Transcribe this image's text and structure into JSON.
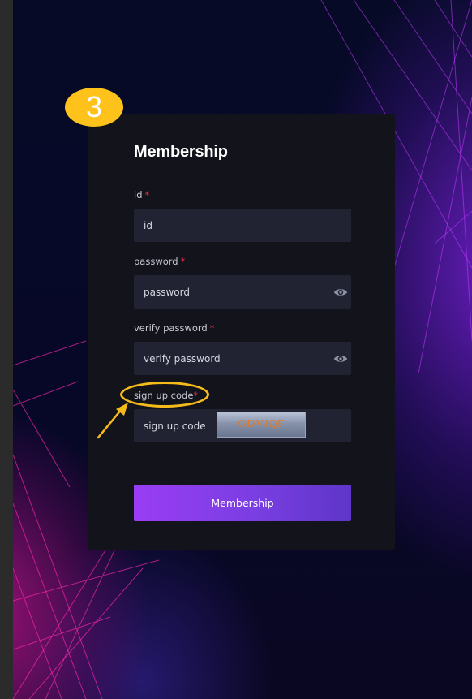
{
  "step_badge": "3",
  "form": {
    "title": "Membership",
    "required_mark": "*",
    "id": {
      "label": "id",
      "placeholder": "id"
    },
    "password": {
      "label": "password",
      "placeholder": "password"
    },
    "verify_password": {
      "label": "verify password",
      "placeholder": "verify password"
    },
    "signup_code": {
      "label": "sign up code",
      "placeholder": "sign up code",
      "captcha": "ODVJQF"
    },
    "submit_label": "Membership"
  },
  "colors": {
    "annotation": "#f5bb1a",
    "button": "#8a3ff0",
    "required": "#e0314b"
  },
  "icons": [
    "eye-icon"
  ]
}
